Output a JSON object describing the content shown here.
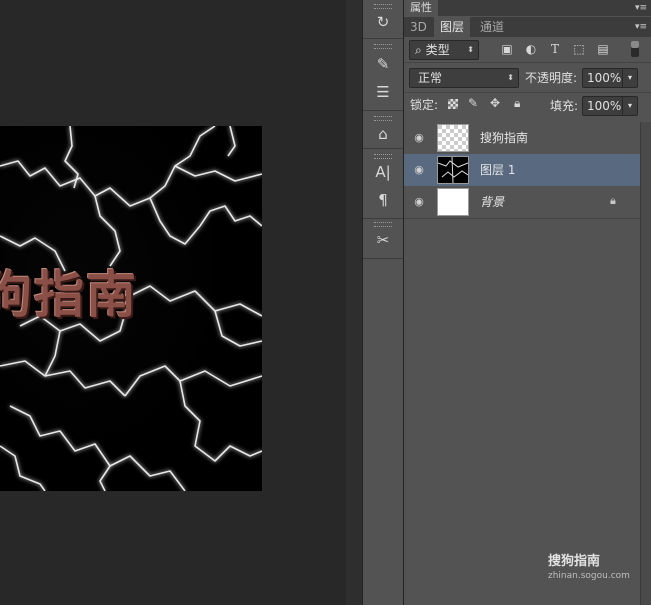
{
  "canvas": {
    "overlay_text": "狗指南"
  },
  "tools": [
    {
      "name": "history-brush-icon",
      "glyph": "↻"
    },
    {
      "name": "brush-preset-icon",
      "glyph": "✎"
    },
    {
      "name": "adjust-sliders-icon",
      "glyph": "☰"
    },
    {
      "name": "clone-stamp-icon",
      "glyph": "⌂"
    },
    {
      "name": "character-icon",
      "glyph": "A|"
    },
    {
      "name": "paragraph-icon",
      "glyph": "¶"
    },
    {
      "name": "tool-presets-icon",
      "glyph": "✂"
    }
  ],
  "panels": {
    "properties_tab": "属性",
    "tabs": [
      "3D",
      "图层",
      "通道"
    ],
    "active_tab": "图层",
    "filter_kind": "类型",
    "filter_icons": [
      "image-filter-icon",
      "adjustment-filter-icon",
      "type-filter-icon",
      "shape-filter-icon",
      "smart-object-filter-icon"
    ],
    "blend_mode": "正常",
    "opacity_label": "不透明度:",
    "opacity_value": "100%",
    "lock_label": "锁定:",
    "fill_label": "填充:",
    "fill_value": "100%",
    "layers": [
      {
        "name": "搜狗指南",
        "thumb": "transparent",
        "selected": false,
        "locked": false
      },
      {
        "name": "图层 1",
        "thumb": "lightning",
        "selected": true,
        "locked": false
      },
      {
        "name": "背景",
        "thumb": "white",
        "selected": false,
        "locked": true
      }
    ]
  },
  "watermark": {
    "logo": "搜狗指南",
    "url": "zhinan.sogou.com"
  }
}
